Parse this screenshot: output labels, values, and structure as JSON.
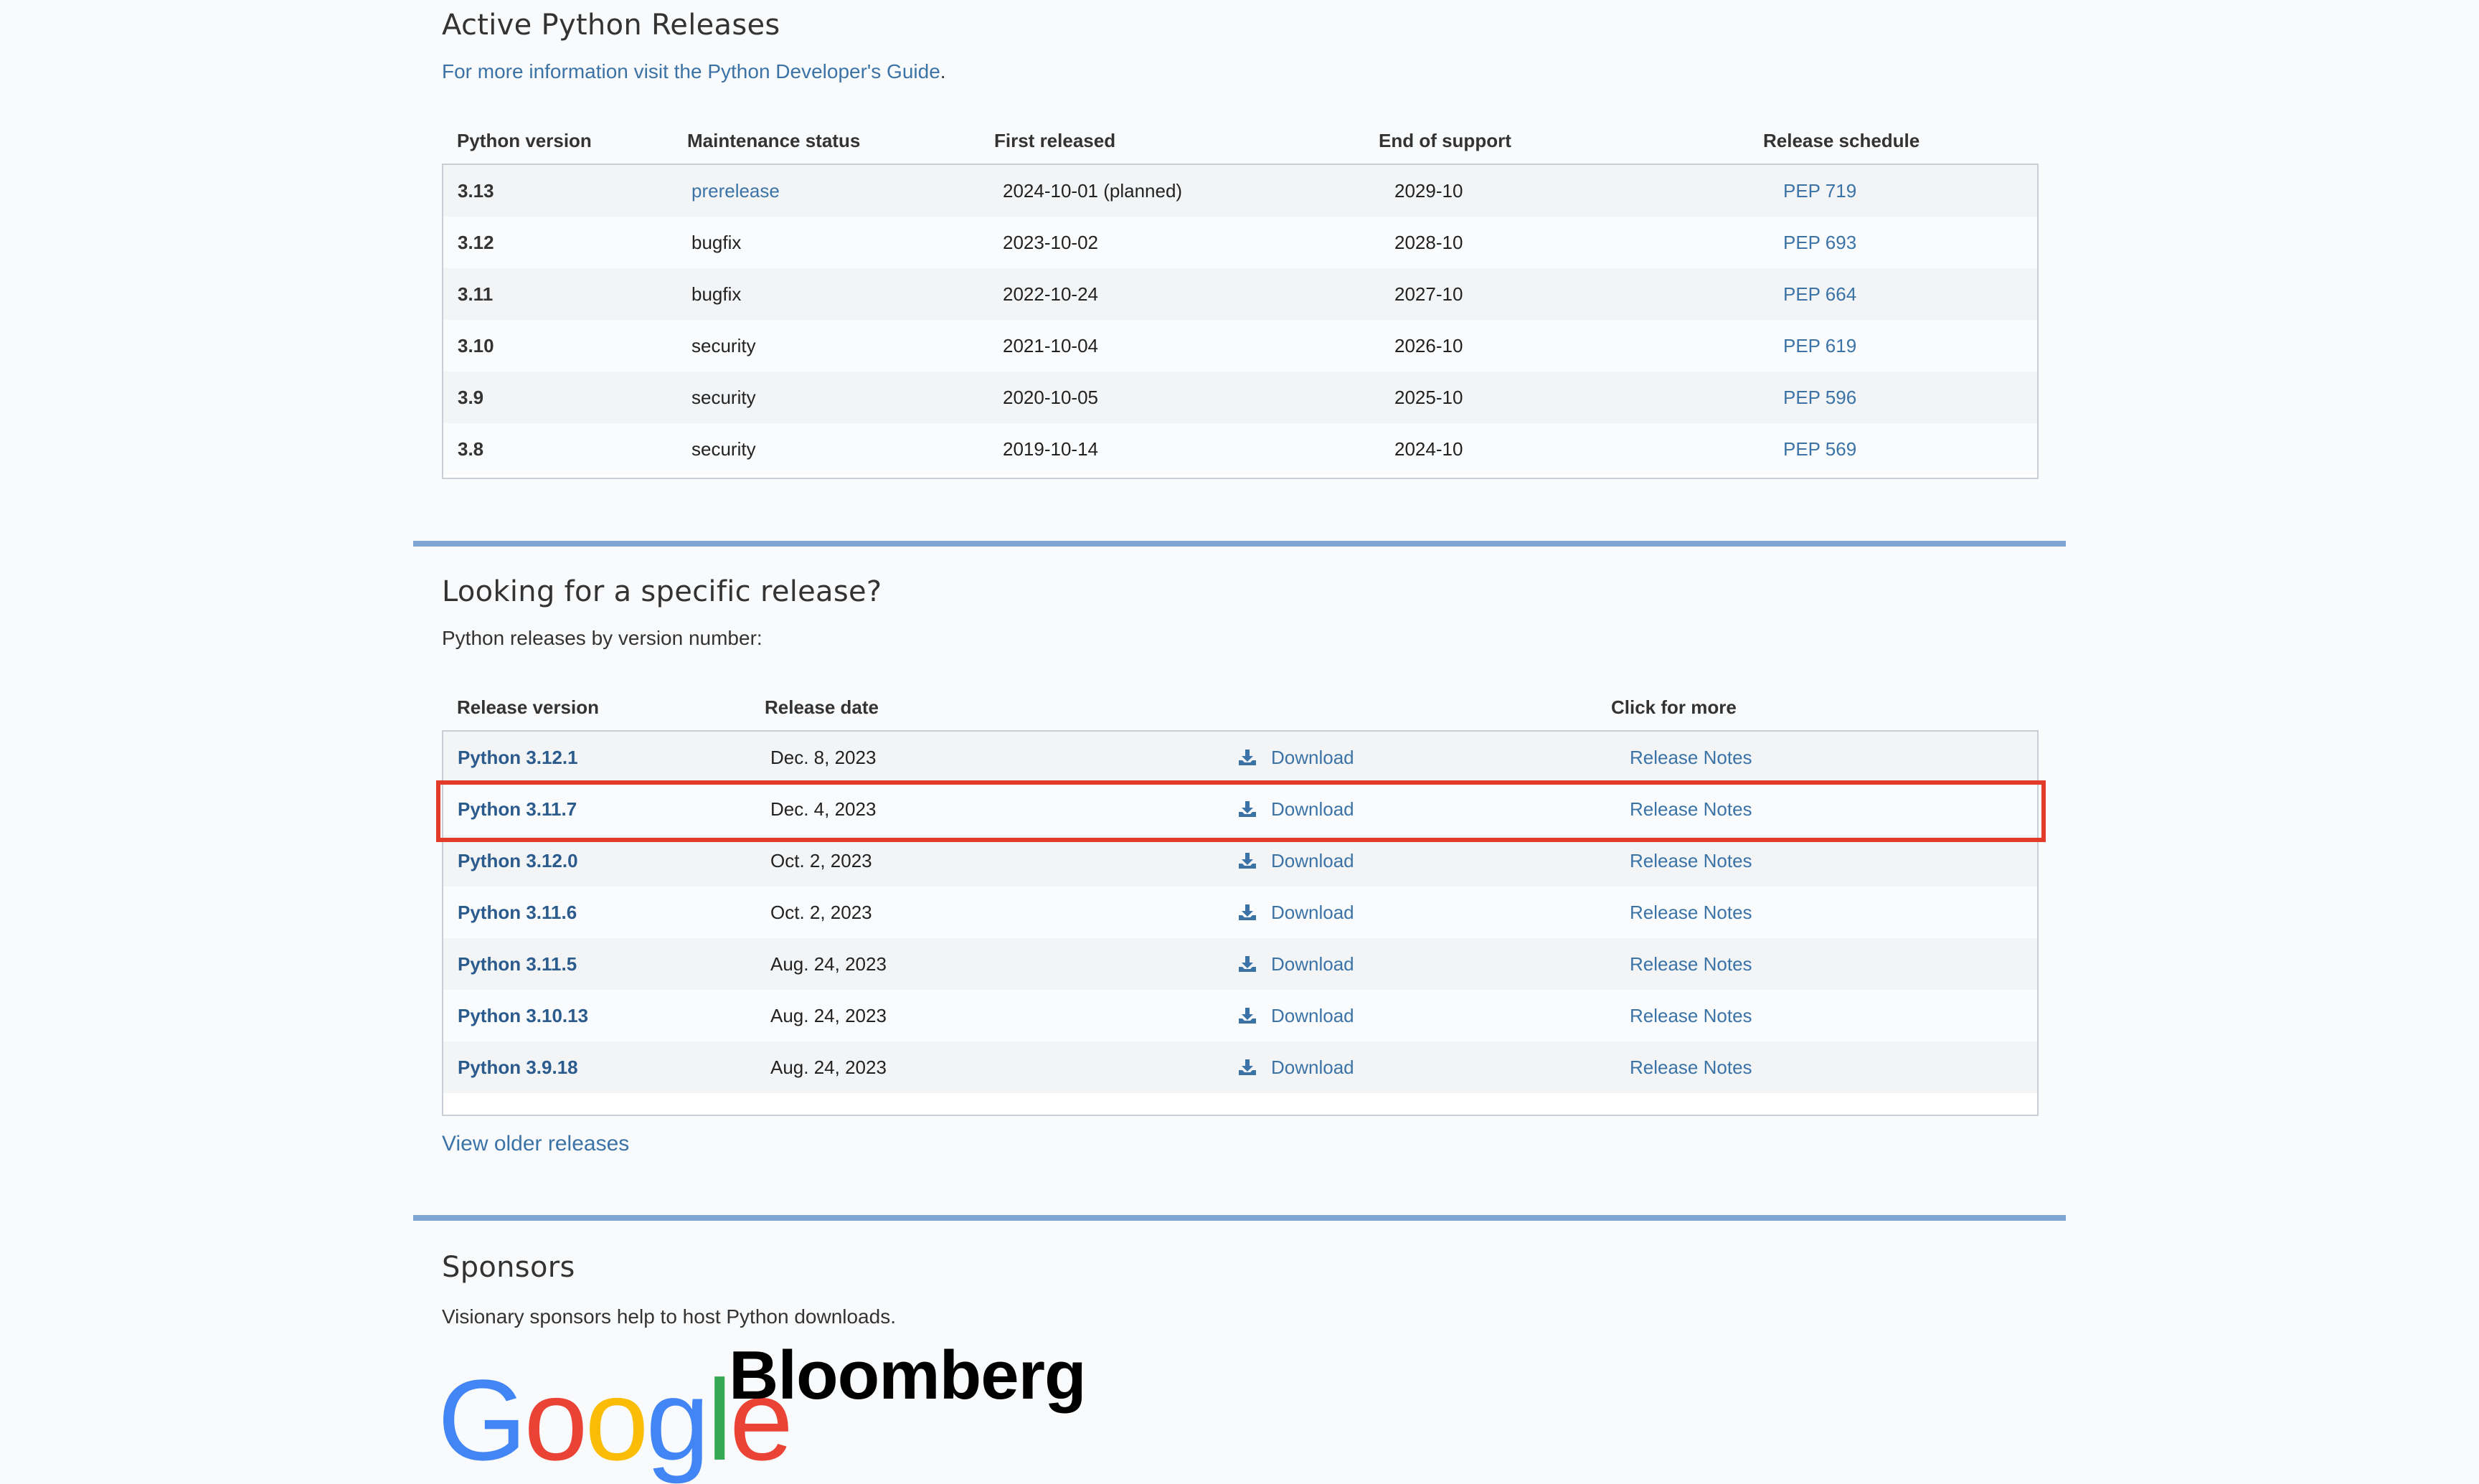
{
  "active": {
    "title": "Active Python Releases",
    "info_link": "For more information visit the Python Developer's Guide",
    "info_suffix": ".",
    "headers": [
      "Python version",
      "Maintenance status",
      "First released",
      "End of support",
      "Release schedule"
    ],
    "rows": [
      {
        "version": "3.13",
        "status": "prerelease",
        "first": "2024-10-01 (planned)",
        "end": "2029-10",
        "pep": "PEP 719"
      },
      {
        "version": "3.12",
        "status": "bugfix",
        "first": "2023-10-02",
        "end": "2028-10",
        "pep": "PEP 693"
      },
      {
        "version": "3.11",
        "status": "bugfix",
        "first": "2022-10-24",
        "end": "2027-10",
        "pep": "PEP 664"
      },
      {
        "version": "3.10",
        "status": "security",
        "first": "2021-10-04",
        "end": "2026-10",
        "pep": "PEP 619"
      },
      {
        "version": "3.9",
        "status": "security",
        "first": "2020-10-05",
        "end": "2025-10",
        "pep": "PEP 596"
      },
      {
        "version": "3.8",
        "status": "security",
        "first": "2019-10-14",
        "end": "2024-10",
        "pep": "PEP 569"
      }
    ]
  },
  "specific": {
    "title": "Looking for a specific release?",
    "subtitle": "Python releases by version number:",
    "headers": [
      "Release version",
      "Release date",
      "Click for more"
    ],
    "download_label": "Download",
    "notes_label": "Release Notes",
    "rows": [
      {
        "version": "Python 3.12.1",
        "date": "Dec. 8, 2023"
      },
      {
        "version": "Python 3.11.7",
        "date": "Dec. 4, 2023"
      },
      {
        "version": "Python 3.12.0",
        "date": "Oct. 2, 2023"
      },
      {
        "version": "Python 3.11.6",
        "date": "Oct. 2, 2023"
      },
      {
        "version": "Python 3.11.5",
        "date": "Aug. 24, 2023"
      },
      {
        "version": "Python 3.10.13",
        "date": "Aug. 24, 2023"
      },
      {
        "version": "Python 3.9.18",
        "date": "Aug. 24, 2023"
      }
    ],
    "view_older": "View older releases"
  },
  "sponsors": {
    "title": "Sponsors",
    "subtitle": "Visionary sponsors help to host Python downloads.",
    "logos": [
      "Google",
      "Bloomberg"
    ]
  },
  "colors": {
    "link": "#3b73a6",
    "highlight": "#e33b2a",
    "section_rule": "#7fa6d2"
  }
}
